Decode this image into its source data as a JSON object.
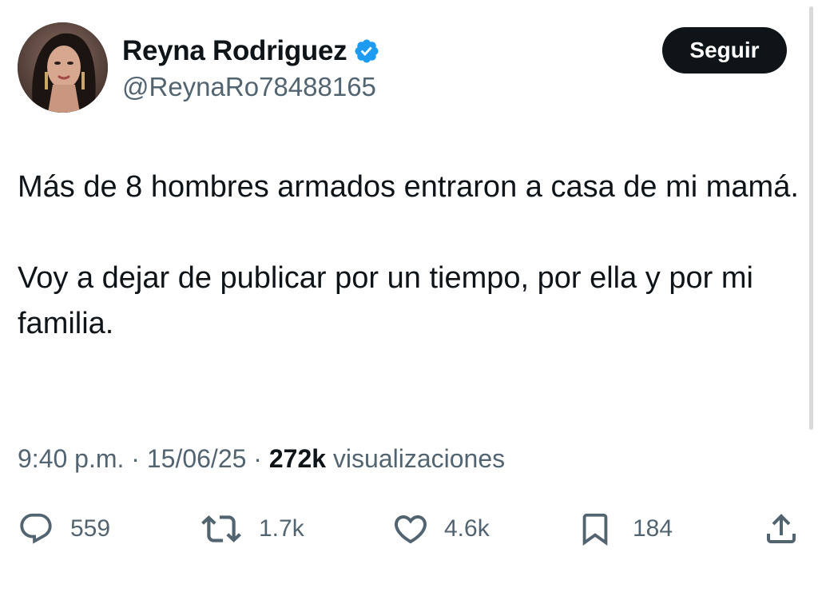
{
  "author": {
    "display_name": "Reyna Rodriguez",
    "handle": "@ReynaRo78488165",
    "verified": true
  },
  "follow_button": {
    "label": "Seguir"
  },
  "tweet": {
    "paragraphs": [
      "Más de 8 hombres armados entraron a casa de mi mamá.",
      "Voy a dejar de publicar por un tiempo, por ella y por mi familia."
    ]
  },
  "meta": {
    "time": "9:40 p.m.",
    "separator": "·",
    "date": "15/06/25",
    "views_count": "272k",
    "views_label": "visualizaciones"
  },
  "actions": {
    "replies": {
      "icon": "reply-icon",
      "count": "559"
    },
    "reposts": {
      "icon": "repost-icon",
      "count": "1.7k"
    },
    "likes": {
      "icon": "heart-icon",
      "count": "4.6k"
    },
    "bookmarks": {
      "icon": "bookmark-icon",
      "count": "184"
    },
    "share": {
      "icon": "share-icon"
    }
  },
  "colors": {
    "text_primary": "#0f1419",
    "text_secondary": "#536471",
    "verified_blue": "#1d9bf0",
    "button_bg": "#0f1419",
    "button_text": "#ffffff"
  }
}
